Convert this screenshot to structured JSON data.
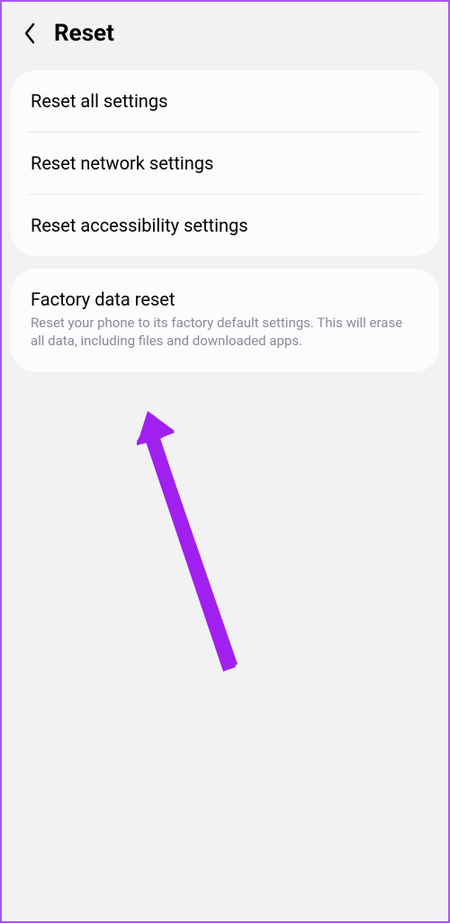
{
  "header": {
    "title": "Reset"
  },
  "group1": {
    "items": [
      {
        "label": "Reset all settings"
      },
      {
        "label": "Reset network settings"
      },
      {
        "label": "Reset accessibility settings"
      }
    ]
  },
  "group2": {
    "item": {
      "label": "Factory data reset",
      "description": "Reset your phone to its factory default settings. This will erase all data, including files and downloaded apps."
    }
  },
  "annotation": {
    "arrow_color": "#a020f0"
  }
}
